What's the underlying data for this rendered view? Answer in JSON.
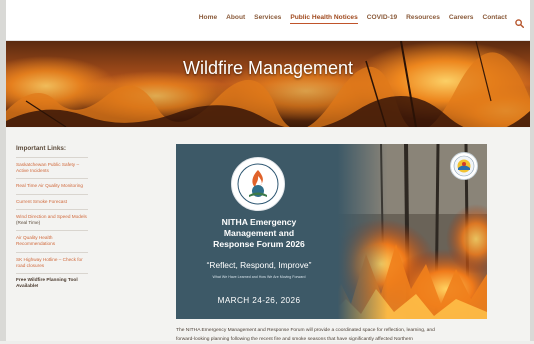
{
  "nav": {
    "items": [
      {
        "label": "Home",
        "active": false
      },
      {
        "label": "About",
        "active": false
      },
      {
        "label": "Services",
        "active": false
      },
      {
        "label": "Public Health Notices",
        "active": true
      },
      {
        "label": "COVID-19",
        "active": false
      },
      {
        "label": "Resources",
        "active": false
      },
      {
        "label": "Careers",
        "active": false
      },
      {
        "label": "Contact",
        "active": false
      }
    ],
    "search_icon": "search-icon"
  },
  "hero": {
    "title": "Wildfire Management"
  },
  "sidebar": {
    "heading": "Important Links:",
    "links": [
      {
        "label": "Saskatchewan Public Safety – Active Incidents"
      },
      {
        "label": "Real Time Air Quality Monitoring"
      },
      {
        "label": "Current Smoke Forecast"
      },
      {
        "label": "Wind Direction and Speed Models",
        "suffix": " (Real Time)"
      },
      {
        "label": "Air Quality Health Recommendations"
      },
      {
        "label": "SK Highway Hotline – Check for road closures"
      },
      {
        "label": "Free Wildfire Planning Tool Available!"
      }
    ]
  },
  "poster": {
    "title_lines": [
      "NITHA Emergency",
      "Management and",
      "Response Forum 2026"
    ],
    "quote": "“Reflect, Respond, Improve”",
    "subtitle": "What We Have Learned and How We Are Moving Forward",
    "date": "MARCH 24-26, 2026"
  },
  "description": {
    "lines": [
      "The NITHA Emergency Management and Response Forum will provide a coordinated space for reflection, learning, and",
      "forward-looking planning following the recent fire and smoke seasons that have significantly affected Northern"
    ]
  },
  "colors": {
    "accent": "#c0532a",
    "nav_text": "#8a5a3a",
    "link": "#d0683a",
    "poster_bg": "#3d5967"
  }
}
